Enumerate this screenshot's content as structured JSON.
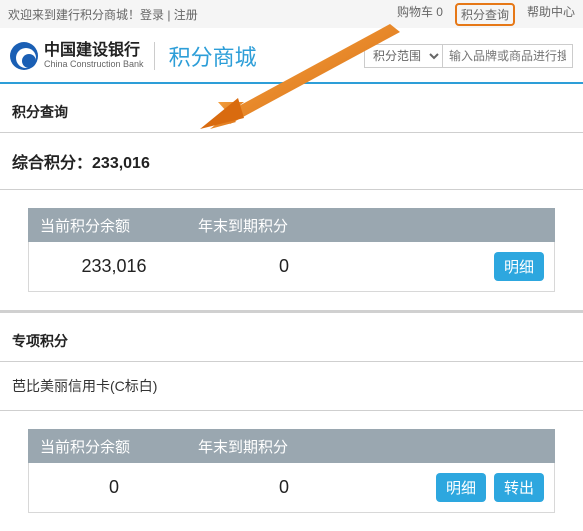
{
  "topbar": {
    "welcome": "欢迎来到建行积分商城！登录 | 注册",
    "cart": "购物车 0",
    "points_query": "积分查询",
    "help": "帮助中心"
  },
  "header": {
    "bank_cn": "中国建设银行",
    "bank_en": "China Construction Bank",
    "mall": "积分商城",
    "scope_option": "积分范围",
    "search_placeholder": "输入品牌或商品进行搜索"
  },
  "query": {
    "title": "积分查询",
    "total_label": "综合积分：",
    "total_value": "233,016"
  },
  "table1": {
    "col1": "当前积分余额",
    "col2": "年末到期积分",
    "balance": "233,016",
    "expiring": "0",
    "detail_btn": "明细"
  },
  "special": {
    "title": "专项积分",
    "card_name": "芭比美丽信用卡(C标白)"
  },
  "table2": {
    "col1": "当前积分余额",
    "col2": "年末到期积分",
    "balance": "0",
    "expiring": "0",
    "detail_btn": "明细",
    "transfer_btn": "转出"
  }
}
